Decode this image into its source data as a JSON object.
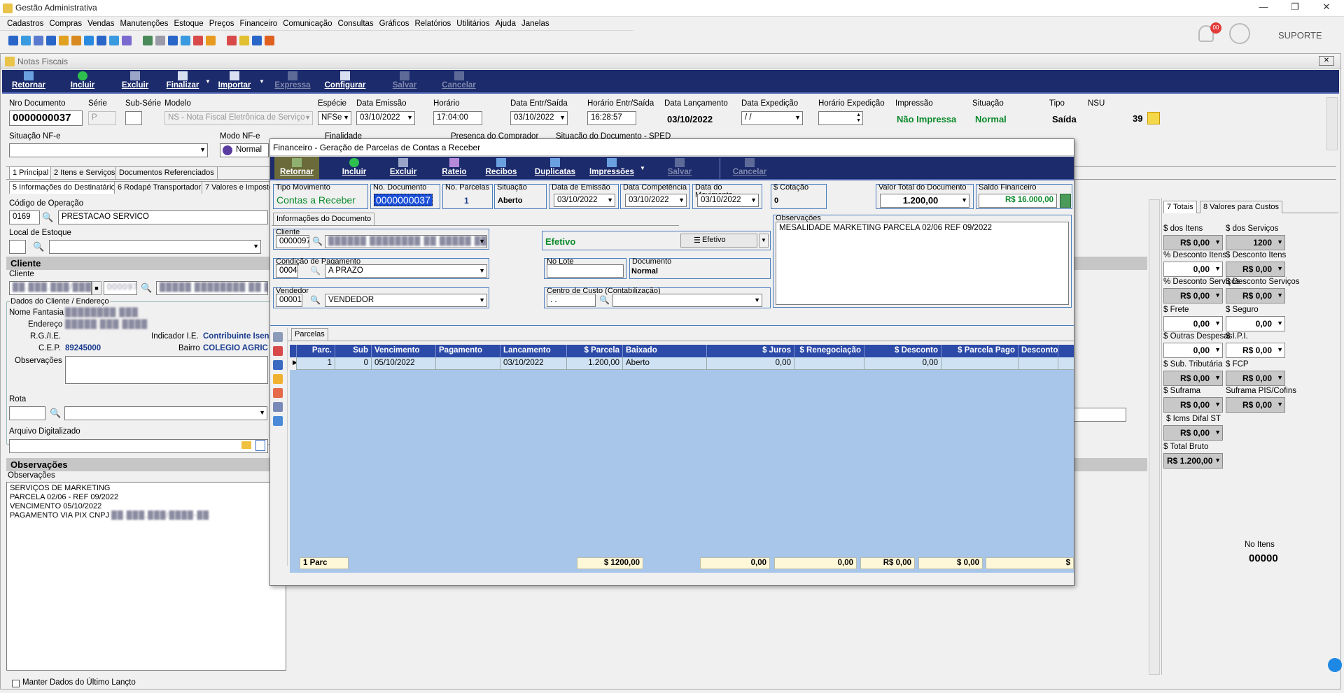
{
  "app": {
    "title": "Gestão Administrativa",
    "suporte": "SUPORTE",
    "notif_count": "00"
  },
  "menu": [
    "Cadastros",
    "Compras",
    "Vendas",
    "Manutenções",
    "Estoque",
    "Preços",
    "Financeiro",
    "Comunicação",
    "Consultas",
    "Gráficos",
    "Relatórios",
    "Utilitários",
    "Ajuda",
    "Janelas"
  ],
  "nf": {
    "window_title": "Notas Fiscais",
    "toolbar": {
      "retornar": "Retornar",
      "incluir": "Incluir",
      "excluir": "Excluir",
      "finalizar": "Finalizar",
      "importar": "Importar",
      "expressa": "Expressa",
      "configurar": "Configurar",
      "salvar": "Salvar",
      "cancelar": "Cancelar"
    },
    "header": {
      "nro_documento_label": "Nro Documento",
      "nro_documento": "0000000037",
      "serie_label": "Série",
      "serie": "P",
      "subserie_label": "Sub-Série",
      "subserie": "",
      "modelo_label": "Modelo",
      "modelo": "NS - Nota Fiscal Eletrônica de Serviço",
      "especie_label": "Espécie",
      "especie": "NFSe",
      "data_emissao_label": "Data Emissão",
      "data_emissao": "03/10/2022",
      "horario_label": "Horário",
      "horario": "17:04:00",
      "data_entr_saida_label": "Data Entr/Saída",
      "data_entr_saida": "03/10/2022",
      "horario_entr_saida_label": "Horário Entr/Saída",
      "horario_entr_saida": "16:28:57",
      "data_lancamento_label": "Data Lançamento",
      "data_lancamento": "03/10/2022",
      "data_expedicao_label": "Data Expedição",
      "data_expedicao": " / /",
      "horario_expedicao_label": "Horário Expedição",
      "horario_expedicao": "",
      "impressao_label": "Impressão",
      "impressao": "Não Impressa",
      "situacao_label": "Situação",
      "situacao": "Normal",
      "tipo_label": "Tipo",
      "tipo": "Saída",
      "nsu_label": "NSU",
      "nsu": "39",
      "situacao_nfe_label": "Situação NF-e",
      "situacao_nfe": "",
      "modo_nfe_label": "Modo NF-e",
      "modo_nfe": "Normal",
      "finalidade_label": "Finalidade",
      "presenca_label": "Presença do Comprador",
      "situacao_doc_label": "Situação do Documento - SPED"
    },
    "tabs1": [
      "1 Principal",
      "2 Itens e Serviços",
      "Documentos Referenciados"
    ],
    "tabs2": [
      "5 Informações do Destinatário",
      "6 Rodapé Transportador",
      "7 Valores e Impostos"
    ],
    "left": {
      "cod_operacao_label": "Código de Operação",
      "cod_operacao": "0169",
      "cod_operacao_desc": "PRESTACAO SERVICO",
      "local_estoque_label": "Local de Estoque",
      "cliente_section": "Cliente",
      "cliente_label": "Cliente",
      "cliente_code": "██.███.███/████-██",
      "cliente_num": "000097",
      "cliente_nome": "█████ ████████ ██ ███",
      "dados_label": "Dados do Cliente / Endereço",
      "nome_fantasia_label": "Nome Fantasia",
      "nome_fantasia": "████████ ███",
      "endereco_label": "Endereço",
      "endereco": "█████ ███ ████",
      "rg_label": "R.G./I.E.",
      "indicador_label": "Indicador I.E.",
      "indicador": "Contribuinte Isen",
      "cep_label": "C.E.P.",
      "cep": "89245000",
      "bairro_label": "Bairro",
      "bairro": "COLEGIO AGRIC",
      "obs_label": "Observações",
      "rota_label": "Rota",
      "arquivo_label": "Arquivo Digitalizado",
      "obs_section": "Observações",
      "obs_sub": "Observações",
      "obs_lines": [
        "SERVIÇOS DE MARKETING",
        "PARCELA 02/06 - REF 09/2022",
        "VENCIMENTO 05/10/2022",
        "PAGAMENTO VIA PIX CNPJ"
      ],
      "obs_cnpj": "██.███.███/████-██",
      "manter": "Manter Dados do Último Lançto"
    },
    "totals": {
      "tabs": [
        "7 Totais",
        "8 Valores para Custos"
      ],
      "items": [
        {
          "label": "$ dos Itens",
          "value": "R$ 0,00",
          "style": "gray"
        },
        {
          "label": "$ dos Serviços",
          "value": "1200",
          "style": "gray"
        },
        {
          "label": "% Desconto Itens",
          "value": "0,00",
          "style": "white"
        },
        {
          "label": "$ Desconto Itens",
          "value": "R$ 0,00",
          "style": "gray"
        },
        {
          "label": "% Desconto Serviços",
          "value": "R$ 0,00",
          "style": "gray"
        },
        {
          "label": "$ Desconto Serviços",
          "value": "R$ 0,00",
          "style": "gray"
        },
        {
          "label": "$ Frete",
          "value": "0,00",
          "style": "white"
        },
        {
          "label": "$ Seguro",
          "value": "0,00",
          "style": "white"
        },
        {
          "label": "$ Outras Despesas",
          "value": "0,00",
          "style": "white"
        },
        {
          "label": "$ I.P.I.",
          "value": "R$ 0,00",
          "style": "white"
        },
        {
          "label": "$ Sub. Tributária",
          "value": "R$ 0,00",
          "style": "gray"
        },
        {
          "label": "$ FCP",
          "value": "R$ 0,00",
          "style": "gray"
        },
        {
          "label": "$ Suframa",
          "value": "R$ 0,00",
          "style": "gray"
        },
        {
          "label": "Suframa PIS/Cofins",
          "value": "R$ 0,00",
          "style": "gray"
        },
        {
          "label": "$ Icms Difal ST",
          "value": "R$ 0,00",
          "style": "gray"
        },
        {
          "label": "$ Total Bruto",
          "value": "R$ 1.200,00",
          "style": "gray"
        }
      ],
      "no_itens_label": "No Itens",
      "no_itens": "00000"
    }
  },
  "modal": {
    "title": "Financeiro - Geração de Parcelas de Contas a Receber",
    "toolbar": {
      "retornar": "Retornar",
      "incluir": "Incluir",
      "excluir": "Excluir",
      "rateio": "Rateio",
      "recibos": "Recibos",
      "duplicatas": "Duplicatas",
      "impressoes": "Impressões",
      "salvar": "Salvar",
      "cancelar": "Cancelar"
    },
    "tipo_mov_label": "Tipo Movimento",
    "tipo_mov": "Contas a Receber",
    "no_doc_label": "No. Documento",
    "no_doc": "0000000037",
    "no_parcelas_label": "No. Parcelas",
    "no_parcelas": "1",
    "situacao_label": "Situação",
    "situacao": "Aberto",
    "data_emissao_label": "Data de Emissão",
    "data_emissao": "03/10/2022",
    "data_comp_label": "Data Competência",
    "data_comp": "03/10/2022",
    "data_mov_label": "Data do Movimento",
    "data_mov": "03/10/2022",
    "cotacao_label": "$ Cotação",
    "cotacao": "0",
    "valor_total_label": "Valor Total do Documento",
    "valor_total": "1.200,00",
    "saldo_label": "Saldo Financeiro",
    "saldo": "R$ 16.000,00",
    "info_tab": "Informações do Documento",
    "cliente_label": "Cliente",
    "cliente_code": "0000097",
    "cliente_nome": "██████ ████████ ██ █████ ███████",
    "efetivo": "Efetivo",
    "efetivo_btn": "Efetivo",
    "cond_label": "Condição de Pagamento",
    "cond_code": "0004",
    "cond": "A PRAZO",
    "no_lote_label": "No Lote",
    "no_lote": "",
    "documento_label": "Documento",
    "documento": "Normal",
    "vendedor_label": "Vendedor",
    "vendedor_code": "00001",
    "vendedor": "VENDEDOR",
    "centro_label": "Centro de Custo (Contabilização)",
    "centro_code": " .  .",
    "obs_label": "Observações",
    "obs": "MESALIDADE MARKETING PARCELA 02/06 REF 09/2022",
    "parcelas_tab": "Parcelas",
    "columns": [
      "Parc.",
      "Sub",
      "Vencimento",
      "Pagamento",
      "Lancamento",
      "$ Parcela",
      "Baixado",
      "$ Juros",
      "$ Renegociação",
      "$ Desconto",
      "$ Parcela Pago",
      "Desconto Pré-F"
    ],
    "rows": [
      [
        "1",
        "0",
        "05/10/2022",
        "",
        "03/10/2022",
        "1.200,00",
        "Aberto",
        "0,00",
        "",
        "0,00",
        "",
        ""
      ]
    ],
    "footer": {
      "parc": "1 Parc",
      "parcela": "$ 1200,00",
      "juros": "0,00",
      "reneg": "0,00",
      "desconto": "R$ 0,00",
      "pago": "$ 0,00",
      "pre": "$"
    }
  }
}
